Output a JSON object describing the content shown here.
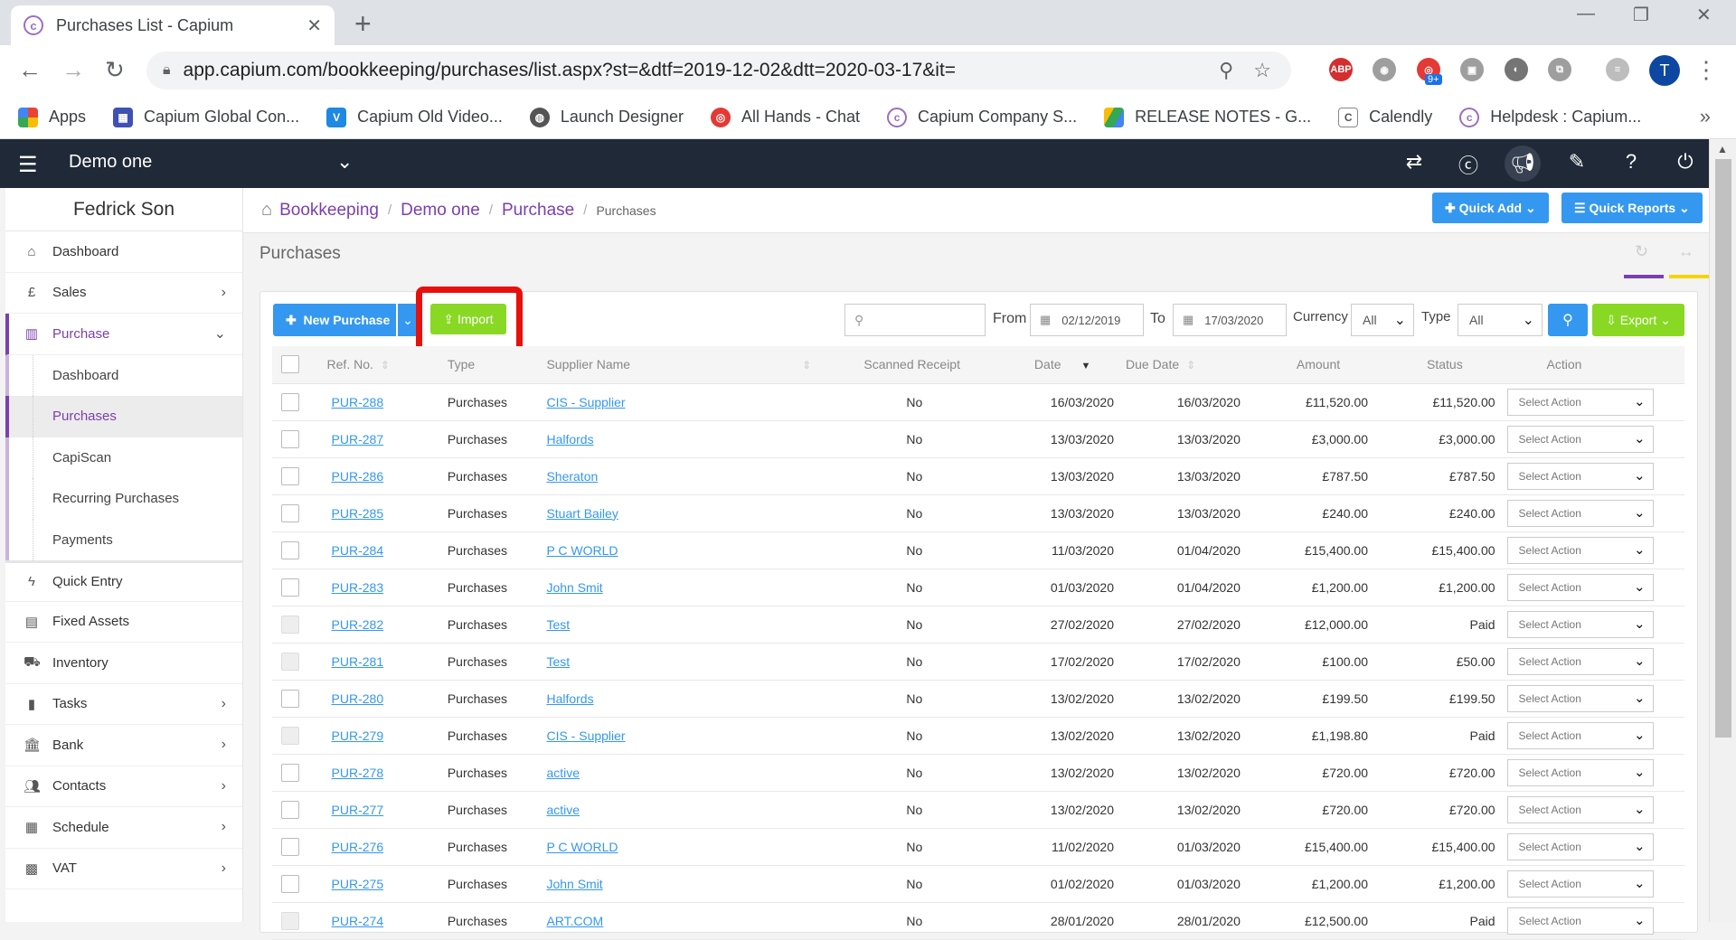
{
  "browser": {
    "tab_title": "Purchases List - Capium",
    "url": "app.capium.com/bookkeeping/purchases/list.aspx?st=&dtf=2019-12-02&dtt=2020-03-17&it=",
    "bookmarks": [
      "Apps",
      "Capium Global Con...",
      "Capium Old Video...",
      "Launch Designer",
      "All Hands - Chat",
      "Capium Company S...",
      "RELEASE NOTES - G...",
      "Calendly",
      "Helpdesk : Capium..."
    ],
    "ext_badge": "9+",
    "abp": "ABP",
    "avatar": "T"
  },
  "header": {
    "company": "Demo one"
  },
  "sidebar": {
    "user": "Fedrick Son",
    "items": {
      "dashboard": "Dashboard",
      "sales": "Sales",
      "purchase": "Purchase",
      "sub_dashboard": "Dashboard",
      "sub_purchases": "Purchases",
      "sub_capiscan": "CapiScan",
      "sub_recurring": "Recurring Purchases",
      "sub_payments": "Payments",
      "quick_entry": "Quick Entry",
      "fixed_assets": "Fixed Assets",
      "inventory": "Inventory",
      "tasks": "Tasks",
      "bank": "Bank",
      "contacts": "Contacts",
      "schedule": "Schedule",
      "vat": "VAT"
    }
  },
  "breadcrumb": {
    "b1": "Bookkeeping",
    "b2": "Demo one",
    "b3": "Purchase",
    "b4": "Purchases"
  },
  "quick": {
    "add": "Quick Add",
    "reports": "Quick Reports"
  },
  "page_title": "Purchases",
  "toolbar": {
    "new_purchase": "New Purchase",
    "import": "Import",
    "from_label": "From",
    "from_value": "02/12/2019",
    "to_label": "To",
    "to_value": "17/03/2020",
    "currency_label": "Currency",
    "currency_value": "All",
    "type_label": "Type",
    "type_value": "All",
    "export": "Export"
  },
  "columns": {
    "ref": "Ref. No.",
    "type": "Type",
    "supplier": "Supplier Name",
    "scanned": "Scanned Receipt",
    "date": "Date",
    "due": "Due Date",
    "amount": "Amount",
    "status": "Status",
    "action": "Action"
  },
  "rows": [
    {
      "ref": "PUR-288",
      "type": "Purchases",
      "supplier": "CIS - Supplier",
      "scanned": "No",
      "date": "16/03/2020",
      "due": "16/03/2020",
      "amount": "£11,520.00",
      "status": "£11,520.00",
      "paid": false,
      "cb_disabled": false,
      "action": "Select Action"
    },
    {
      "ref": "PUR-287",
      "type": "Purchases",
      "supplier": "Halfords",
      "scanned": "No",
      "date": "13/03/2020",
      "due": "13/03/2020",
      "amount": "£3,000.00",
      "status": "£3,000.00",
      "paid": false,
      "cb_disabled": false,
      "action": "Select Action"
    },
    {
      "ref": "PUR-286",
      "type": "Purchases",
      "supplier": "Sheraton",
      "scanned": "No",
      "date": "13/03/2020",
      "due": "13/03/2020",
      "amount": "£787.50",
      "status": "£787.50",
      "paid": false,
      "cb_disabled": false,
      "action": "Select Action"
    },
    {
      "ref": "PUR-285",
      "type": "Purchases",
      "supplier": "Stuart Bailey",
      "scanned": "No",
      "date": "13/03/2020",
      "due": "13/03/2020",
      "amount": "£240.00",
      "status": "£240.00",
      "paid": false,
      "cb_disabled": false,
      "action": "Select Action"
    },
    {
      "ref": "PUR-284",
      "type": "Purchases",
      "supplier": "P C WORLD",
      "scanned": "No",
      "date": "11/03/2020",
      "due": "01/04/2020",
      "amount": "£15,400.00",
      "status": "£15,400.00",
      "paid": false,
      "cb_disabled": false,
      "action": "Select Action"
    },
    {
      "ref": "PUR-283",
      "type": "Purchases",
      "supplier": "John Smit",
      "scanned": "No",
      "date": "01/03/2020",
      "due": "01/04/2020",
      "amount": "£1,200.00",
      "status": "£1,200.00",
      "paid": false,
      "cb_disabled": false,
      "action": "Select Action"
    },
    {
      "ref": "PUR-282",
      "type": "Purchases",
      "supplier": "Test",
      "scanned": "No",
      "date": "27/02/2020",
      "due": "27/02/2020",
      "amount": "£12,000.00",
      "status": "Paid",
      "paid": true,
      "cb_disabled": true,
      "action": "Select Action"
    },
    {
      "ref": "PUR-281",
      "type": "Purchases",
      "supplier": "Test",
      "scanned": "No",
      "date": "17/02/2020",
      "due": "17/02/2020",
      "amount": "£100.00",
      "status": "£50.00",
      "paid": false,
      "cb_disabled": true,
      "action": "Select Action"
    },
    {
      "ref": "PUR-280",
      "type": "Purchases",
      "supplier": "Halfords",
      "scanned": "No",
      "date": "13/02/2020",
      "due": "13/02/2020",
      "amount": "£199.50",
      "status": "£199.50",
      "paid": false,
      "cb_disabled": false,
      "action": "Select Action"
    },
    {
      "ref": "PUR-279",
      "type": "Purchases",
      "supplier": "CIS - Supplier",
      "scanned": "No",
      "date": "13/02/2020",
      "due": "13/02/2020",
      "amount": "£1,198.80",
      "status": "Paid",
      "paid": true,
      "cb_disabled": true,
      "action": "Select Action"
    },
    {
      "ref": "PUR-278",
      "type": "Purchases",
      "supplier": "active",
      "scanned": "No",
      "date": "13/02/2020",
      "due": "13/02/2020",
      "amount": "£720.00",
      "status": "£720.00",
      "paid": false,
      "cb_disabled": false,
      "action": "Select Action"
    },
    {
      "ref": "PUR-277",
      "type": "Purchases",
      "supplier": "active",
      "scanned": "No",
      "date": "13/02/2020",
      "due": "13/02/2020",
      "amount": "£720.00",
      "status": "£720.00",
      "paid": false,
      "cb_disabled": false,
      "action": "Select Action"
    },
    {
      "ref": "PUR-276",
      "type": "Purchases",
      "supplier": "P C WORLD",
      "scanned": "No",
      "date": "11/02/2020",
      "due": "01/03/2020",
      "amount": "£15,400.00",
      "status": "£15,400.00",
      "paid": false,
      "cb_disabled": false,
      "action": "Select Action"
    },
    {
      "ref": "PUR-275",
      "type": "Purchases",
      "supplier": "John Smit",
      "scanned": "No",
      "date": "01/02/2020",
      "due": "01/03/2020",
      "amount": "£1,200.00",
      "status": "£1,200.00",
      "paid": false,
      "cb_disabled": false,
      "action": "Select Action"
    },
    {
      "ref": "PUR-274",
      "type": "Purchases",
      "supplier": "ART.COM",
      "scanned": "No",
      "date": "28/01/2020",
      "due": "28/01/2020",
      "amount": "£12,500.00",
      "status": "Paid",
      "paid": true,
      "cb_disabled": true,
      "action": "Select Action"
    }
  ]
}
